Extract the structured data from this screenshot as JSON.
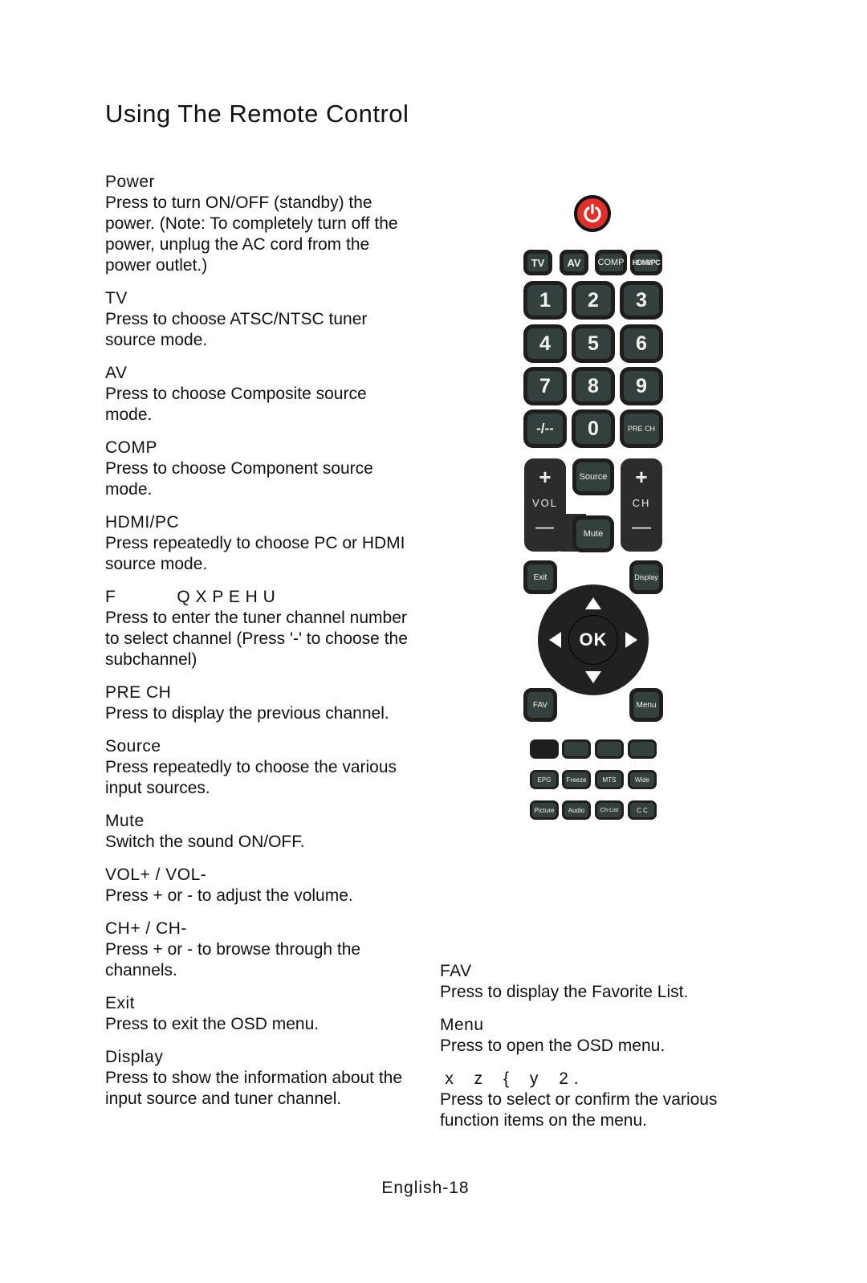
{
  "page": {
    "title": "Using The Remote Control",
    "footer": "English-18"
  },
  "left_entries": [
    {
      "title": "Power",
      "desc": "Press to turn ON/OFF (standby) the power. (Note: To completely turn off the power, unplug the AC cord from the power outlet.)"
    },
    {
      "title": "TV",
      "desc": "Press to choose ATSC/NTSC tuner source mode."
    },
    {
      "title": "AV",
      "desc": "Press to choose Composite source mode."
    },
    {
      "title": "COMP",
      "desc": "Press to choose Component source mode."
    },
    {
      "title": "HDMI/PC",
      "desc": "Press repeatedly to choose PC or HDMI source mode."
    },
    {
      "title": "F            Q X P E H U",
      "desc": "Press to enter the tuner channel number to select channel (Press '-' to choose the subchannel)"
    },
    {
      "title": "PRE CH",
      "desc": "Press to display the previous channel."
    },
    {
      "title": "Source",
      "desc": "Press repeatedly to choose the various input sources."
    },
    {
      "title": "Mute",
      "desc": "Switch the sound ON/OFF."
    },
    {
      "title": "VOL+ / VOL-",
      "desc": "Press + or - to adjust the volume."
    },
    {
      "title": "CH+ / CH-",
      "desc": "Press + or - to browse through the channels."
    },
    {
      "title": "Exit",
      "desc": "Press to exit the OSD menu."
    },
    {
      "title": "Display",
      "desc": "Press to show the information about the input source and tuner channel."
    }
  ],
  "right_entries": [
    {
      "title": "FAV",
      "desc": "Press to display the Favorite List."
    },
    {
      "title": "Menu",
      "desc": "Press to open the OSD menu."
    },
    {
      "title": " x    z    {    y    2 .",
      "desc": "Press to select or confirm the various function items on the menu."
    }
  ],
  "remote": {
    "colors": {
      "button_face": "#34403d",
      "button_border": "#1e1f1d",
      "power": "#e0302b",
      "body_dark": "#202120"
    },
    "source_row": [
      "TV",
      "AV",
      "COMP",
      "HDMI/PC"
    ],
    "number_pad": [
      "1",
      "2",
      "3",
      "4",
      "5",
      "6",
      "7",
      "8",
      "9",
      "-/--",
      "0",
      "PRE CH"
    ],
    "vol": {
      "plus": "+",
      "label": "VOL",
      "minus": "—"
    },
    "ch": {
      "plus": "+",
      "label": "CH",
      "minus": "—"
    },
    "source": "Source",
    "mute": "Mute",
    "exit": "Exit",
    "display": "Display",
    "ok": "OK",
    "fav": "FAV",
    "menu": "Menu",
    "function_row1": [
      "EPG",
      "Freeze",
      "MTS",
      "Wide"
    ],
    "function_row2": [
      "Picture",
      "Audio",
      "Ch-List",
      "C C"
    ]
  }
}
